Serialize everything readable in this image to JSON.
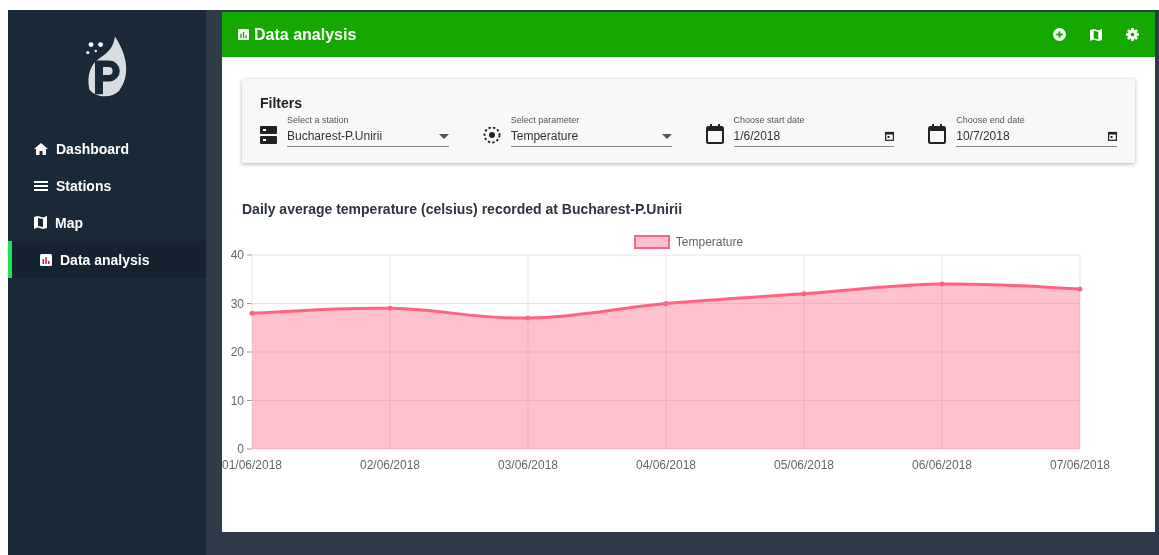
{
  "sidebar": {
    "items": [
      {
        "label": "Dashboard",
        "selected": false
      },
      {
        "label": "Stations",
        "selected": false
      },
      {
        "label": "Map",
        "selected": false
      },
      {
        "label": "Data analysis",
        "selected": true
      }
    ]
  },
  "header": {
    "title": "Data analysis"
  },
  "filters": {
    "title": "Filters",
    "fields": [
      {
        "kind": "select",
        "label": "Select a station",
        "value": "Bucharest-P.Unirii"
      },
      {
        "kind": "select",
        "label": "Select parameter",
        "value": "Temperature"
      },
      {
        "kind": "date",
        "label": "Choose start date",
        "value": "1/6/2018"
      },
      {
        "kind": "date",
        "label": "Choose end date",
        "value": "10/7/2018"
      }
    ]
  },
  "chart_title": "Daily average temperature (celsius) recorded at Bucharest-P.Unirii",
  "chart_data": {
    "type": "area",
    "categories": [
      "01/06/2018",
      "02/06/2018",
      "03/06/2018",
      "04/06/2018",
      "05/06/2018",
      "06/06/2018",
      "07/06/2018"
    ],
    "series": [
      {
        "name": "Temperature",
        "color": "#ff6384",
        "values": [
          28,
          29,
          27,
          30,
          32,
          34,
          33
        ]
      }
    ],
    "ylim": [
      0,
      40
    ],
    "yticks": [
      0,
      10,
      20,
      30,
      40
    ],
    "grid": true
  }
}
